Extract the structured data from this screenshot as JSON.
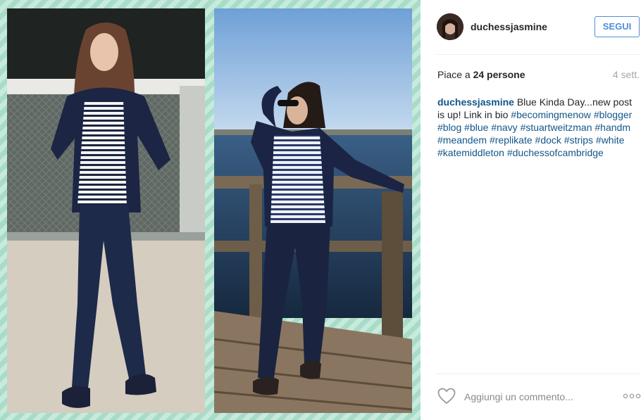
{
  "post": {
    "username": "duchessjasmine",
    "follow_label": "SEGUI",
    "likes_prefix": "Piace a ",
    "likes_count": "24",
    "likes_suffix": " persone",
    "time_ago": "4 sett.",
    "caption_user": "duchessjasmine",
    "caption_text": " Blue Kinda Day...new post is up! Link in bio ",
    "hashtags": [
      "#becomingmenow",
      "#blogger",
      "#blog",
      "#blue",
      "#navy",
      "#stuartweitzman",
      "#handm",
      "#meandem",
      "#replikate",
      "#dock",
      "#strips",
      "#white",
      "#katemiddleton",
      "#duchessofcambridge"
    ],
    "comment_placeholder": "Aggiungi un commento...",
    "icons": {
      "like": "heart-icon",
      "more": "more-options-icon"
    }
  },
  "colors": {
    "accent": "#4f8fd6",
    "link": "#125688",
    "muted": "#a5a7aa",
    "border_stripe_a": "#a8dcc8",
    "border_stripe_b": "#c6ebdc"
  }
}
